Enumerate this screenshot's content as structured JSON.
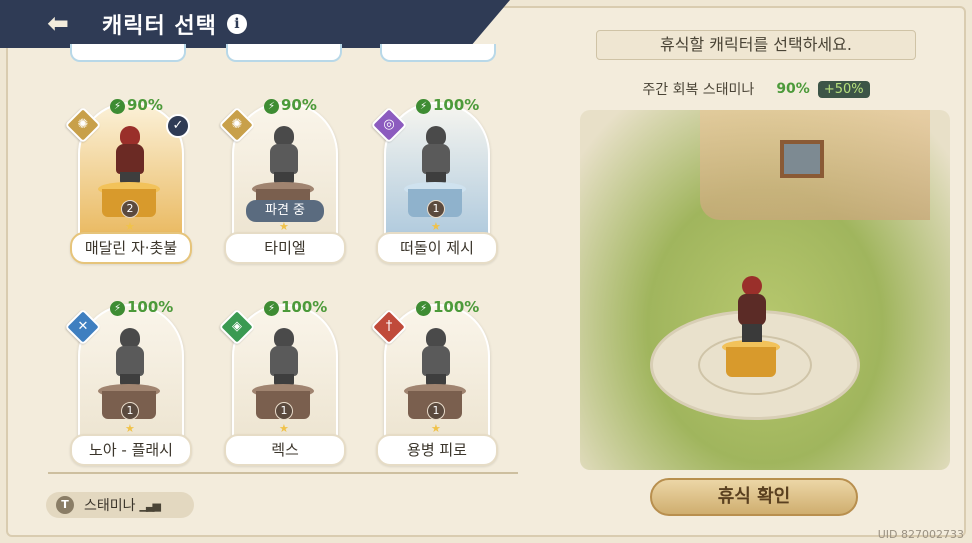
{
  "header": {
    "title": "캐릭터 선택",
    "back_icon": "back-arrow-icon",
    "info_icon": "i"
  },
  "characters": [
    {
      "name": "매달린 자·촛불",
      "stamina": "90%",
      "level": "2",
      "class": "sun-icon",
      "class_color": "#c8a04a",
      "selected": true
    },
    {
      "name": "타미엘",
      "stamina": "90%",
      "status": "파견 중",
      "class": "sun-icon",
      "class_color": "#c8a04a"
    },
    {
      "name": "떠돌이 제시",
      "stamina": "100%",
      "level": "1",
      "class": "swirl-icon",
      "class_color": "#8c5bbf"
    },
    {
      "name": "노아 - 플래시",
      "stamina": "100%",
      "level": "1",
      "class": "cross-icon",
      "class_color": "#3f7fc0"
    },
    {
      "name": "렉스",
      "stamina": "100%",
      "level": "1",
      "class": "shield-icon",
      "class_color": "#3a9a52"
    },
    {
      "name": "용병 피로",
      "stamina": "100%",
      "level": "1",
      "class": "sword-icon",
      "class_color": "#c04a3a"
    }
  ],
  "stamina_button": {
    "label": "스태미나",
    "icon": "T"
  },
  "right_panel": {
    "prompt": "휴식할 캐릭터를 선택하세요.",
    "weekly_label": "주간 회복 스태미나",
    "weekly_pct": "90%",
    "weekly_bonus": "+50%",
    "confirm_label": "휴식 확인"
  },
  "uid": "UID 827002733"
}
